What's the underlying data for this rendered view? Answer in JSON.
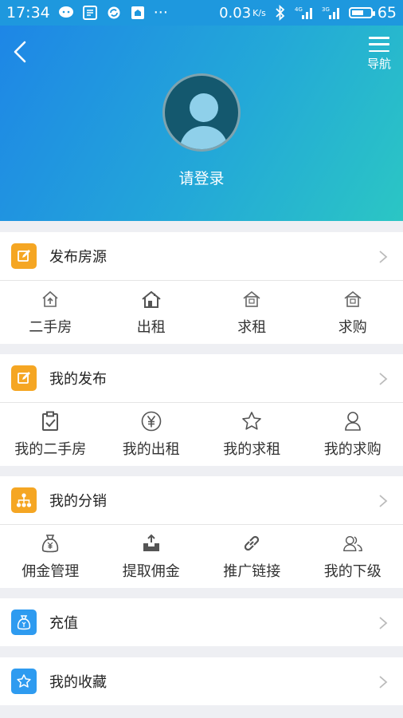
{
  "status_bar": {
    "time": "17:34",
    "notif_more": "···",
    "speed": "0.03",
    "speed_unit": "K/s",
    "net1": "4G",
    "net2": "3G",
    "battery": "65",
    "battery_level": 0.65
  },
  "header": {
    "back_icon": "chevron-left-icon",
    "nav_label": "导航",
    "login_text": "请登录"
  },
  "sections": {
    "publish": {
      "title": "发布房源",
      "badge_color": "#f5a623",
      "items": [
        "二手房",
        "出租",
        "求租",
        "求购"
      ]
    },
    "my_posts": {
      "title": "我的发布",
      "badge_color": "#f5a623",
      "items": [
        "我的二手房",
        "我的出租",
        "我的求租",
        "我的求购"
      ]
    },
    "distribution": {
      "title": "我的分销",
      "badge_color": "#f5a623",
      "items": [
        "佣金管理",
        "提取佣金",
        "推广链接",
        "我的下级"
      ]
    },
    "recharge": {
      "title": "充值",
      "badge_color": "#2e9bf0"
    },
    "favorites": {
      "title": "我的收藏",
      "badge_color": "#2e9bf0"
    }
  },
  "colors": {
    "header_start": "#1e86e6",
    "header_end": "#2bc6c4",
    "page_bg": "#eeeff3",
    "icon_gray": "#666666"
  }
}
